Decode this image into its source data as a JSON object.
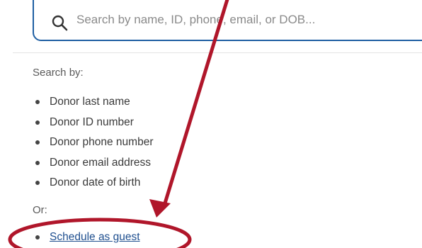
{
  "search": {
    "placeholder": "Search by name, ID, phone, email, or DOB...",
    "value": ""
  },
  "criteria": {
    "heading": "Search by:",
    "items": [
      "Donor last name",
      "Donor ID number",
      "Donor phone number",
      "Donor email address",
      "Donor date of birth"
    ]
  },
  "alternative": {
    "heading": "Or:",
    "guest_link": "Schedule as guest"
  },
  "icons": {
    "search": "search-icon"
  },
  "colors": {
    "search_border": "#1f5fa3",
    "link": "#1f4f8f",
    "annotation": "#b0162a"
  }
}
